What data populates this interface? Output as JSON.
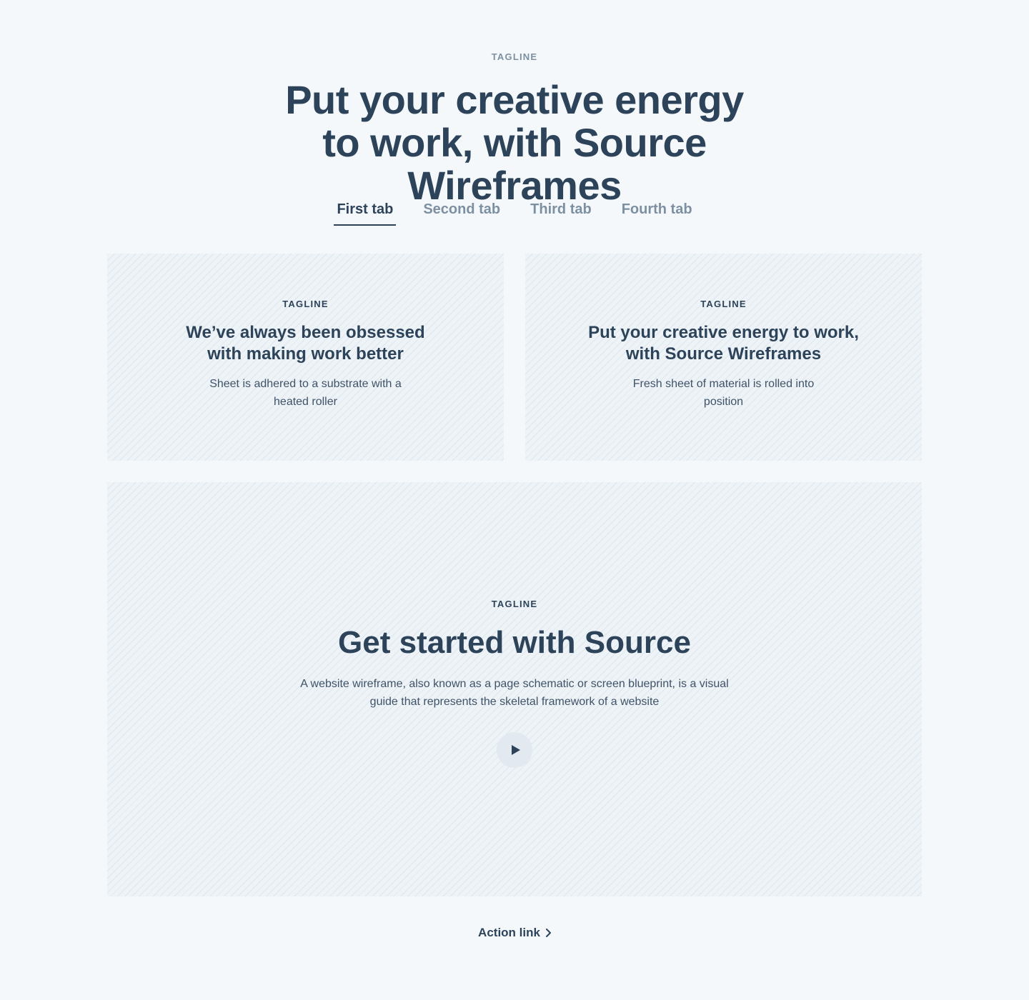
{
  "header": {
    "tagline": "TAGLINE",
    "title": "Put your creative energy to work, with Source Wireframes"
  },
  "tabs": [
    {
      "label": "First tab",
      "active": true
    },
    {
      "label": "Second tab",
      "active": false
    },
    {
      "label": "Third tab",
      "active": false
    },
    {
      "label": "Fourth tab",
      "active": false
    }
  ],
  "cards": [
    {
      "tagline": "TAGLINE",
      "title": "We’ve always been obsessed with making work better",
      "description": "Sheet is adhered to a substrate with a heated roller"
    },
    {
      "tagline": "TAGLINE",
      "title": "Put your creative energy to work, with Source Wireframes",
      "description": "Fresh sheet of material is rolled into position"
    }
  ],
  "feature": {
    "tagline": "TAGLINE",
    "title": "Get started with Source",
    "description": "A website wireframe, also known as a page schematic or screen blueprint, is a visual guide that represents the skeletal framework of a website",
    "play_icon": "play-icon"
  },
  "action": {
    "label": "Action link",
    "icon": "chevron-right-icon"
  },
  "colors": {
    "background": "#f4f8fb",
    "text": "#2d435a",
    "muted": "#7d90a1"
  }
}
